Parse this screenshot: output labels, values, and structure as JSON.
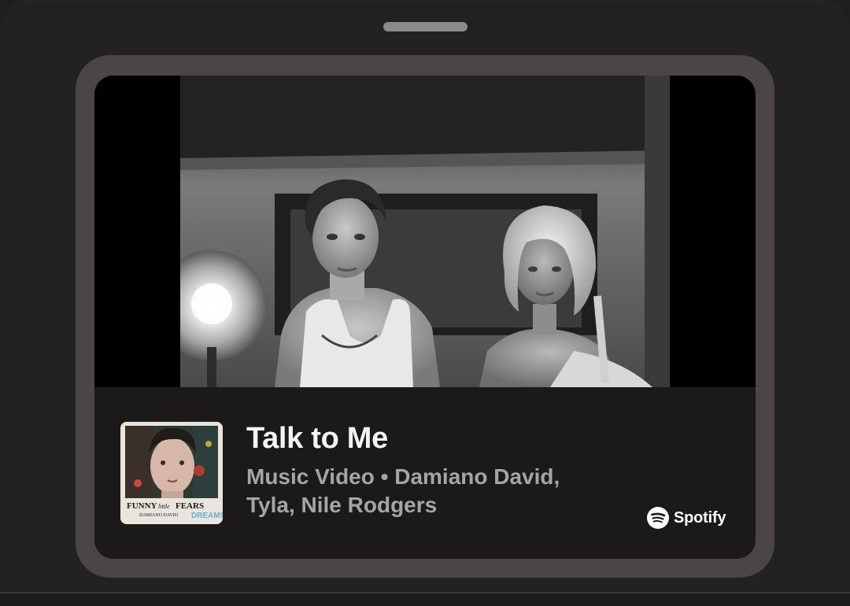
{
  "track": {
    "title": "Talk to Me",
    "subtitle_line1": "Music Video • Damiano David,",
    "subtitle_line2": "Tyla, Nile Rodgers"
  },
  "album_art": {
    "title_funny": "FUNNY",
    "title_little": "little",
    "title_fears": "FEARS",
    "artist": "DAMIANO DAVID",
    "dreams": "DREAMS"
  },
  "brand": {
    "name": "Spotify",
    "icon": "spotify-logo-icon"
  },
  "colors": {
    "frame": "#4c4545",
    "card_bg": "#1b1919",
    "title": "#f4f4f4",
    "subtitle": "#a5a5a5"
  }
}
